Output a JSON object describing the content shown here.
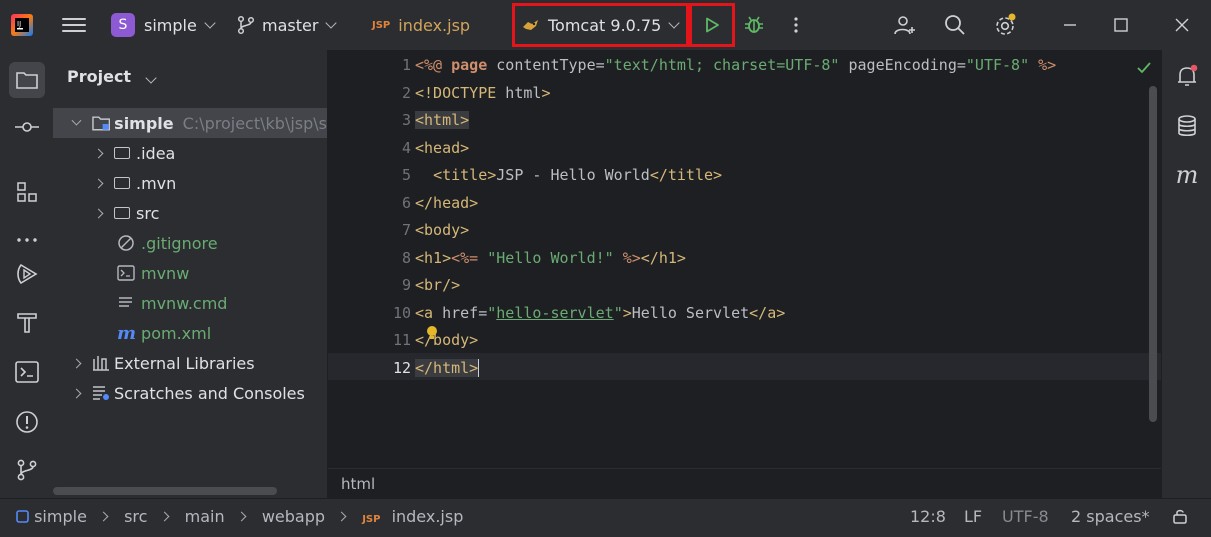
{
  "titlebar": {
    "project_badge": "S",
    "project_name": "simple",
    "branch": "master",
    "open_file": "index.jsp",
    "open_file_badge": "JSP",
    "run_config": "Tomcat 9.0.75"
  },
  "project_panel": {
    "title": "Project",
    "root_name": "simple",
    "root_path": "C:\\project\\kb\\jsp\\s",
    "items": [
      {
        "label": ".idea"
      },
      {
        "label": ".mvn"
      },
      {
        "label": "src"
      },
      {
        "label": ".gitignore"
      },
      {
        "label": "mvnw"
      },
      {
        "label": "mvnw.cmd"
      },
      {
        "label": "pom.xml"
      },
      {
        "label": "External Libraries"
      },
      {
        "label": "Scratches and Consoles"
      }
    ]
  },
  "editor": {
    "line_numbers": [
      "1",
      "2",
      "3",
      "4",
      "5",
      "6",
      "7",
      "8",
      "9",
      "10",
      "11",
      "12"
    ],
    "breadcrumb": "html"
  },
  "statusbar": {
    "path": [
      "simple",
      "src",
      "main",
      "webapp",
      "index.jsp"
    ],
    "file_badge": "JSP",
    "position": "12:8",
    "line_ending": "LF",
    "encoding": "UTF-8",
    "indent": "2 spaces*"
  },
  "colors": {
    "highlight_box": "#e3151a",
    "run_green": "#5fb865",
    "project_badge": "#8e5ad4"
  }
}
